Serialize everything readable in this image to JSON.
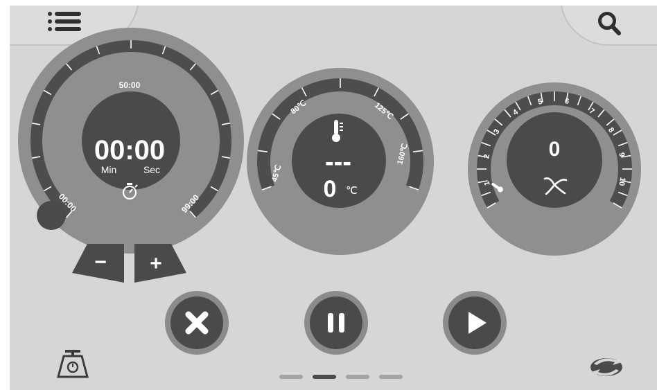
{
  "top_bar": {
    "menu_icon": "list-icon",
    "search_icon": "search-icon"
  },
  "timer": {
    "display": "00:00",
    "min_label": "Min",
    "sec_label": "Sec",
    "tick_start": "00:00",
    "tick_mid": "50:00",
    "tick_end": "99:00",
    "icon": "stopwatch-icon",
    "minus_label": "−",
    "plus_label": "+"
  },
  "temperature": {
    "display": "---",
    "value": "0",
    "unit": "℃",
    "icon": "thermometer-icon",
    "ticks": [
      "45℃",
      "80℃",
      "125℃",
      "160℃"
    ]
  },
  "fan": {
    "value": "0",
    "icon": "fan-icon",
    "ticks": [
      "1",
      "2",
      "3",
      "4",
      "5",
      "6",
      "7",
      "8",
      "9",
      "10"
    ],
    "zero_icon": "thermometer-small-icon"
  },
  "controls": {
    "stop_icon": "close-icon",
    "pause_icon": "pause-icon",
    "play_icon": "play-icon"
  },
  "footer": {
    "scale_icon": "scale-icon",
    "sync_icon": "sync-icon",
    "pages": 4,
    "active_page": 2
  },
  "colors": {
    "background": "#d6d6d6",
    "dial_outer": "#8f8f8f",
    "dial_track": "#4d4d4d",
    "dial_center": "#4a4a4a",
    "text_light": "#ffffff"
  }
}
